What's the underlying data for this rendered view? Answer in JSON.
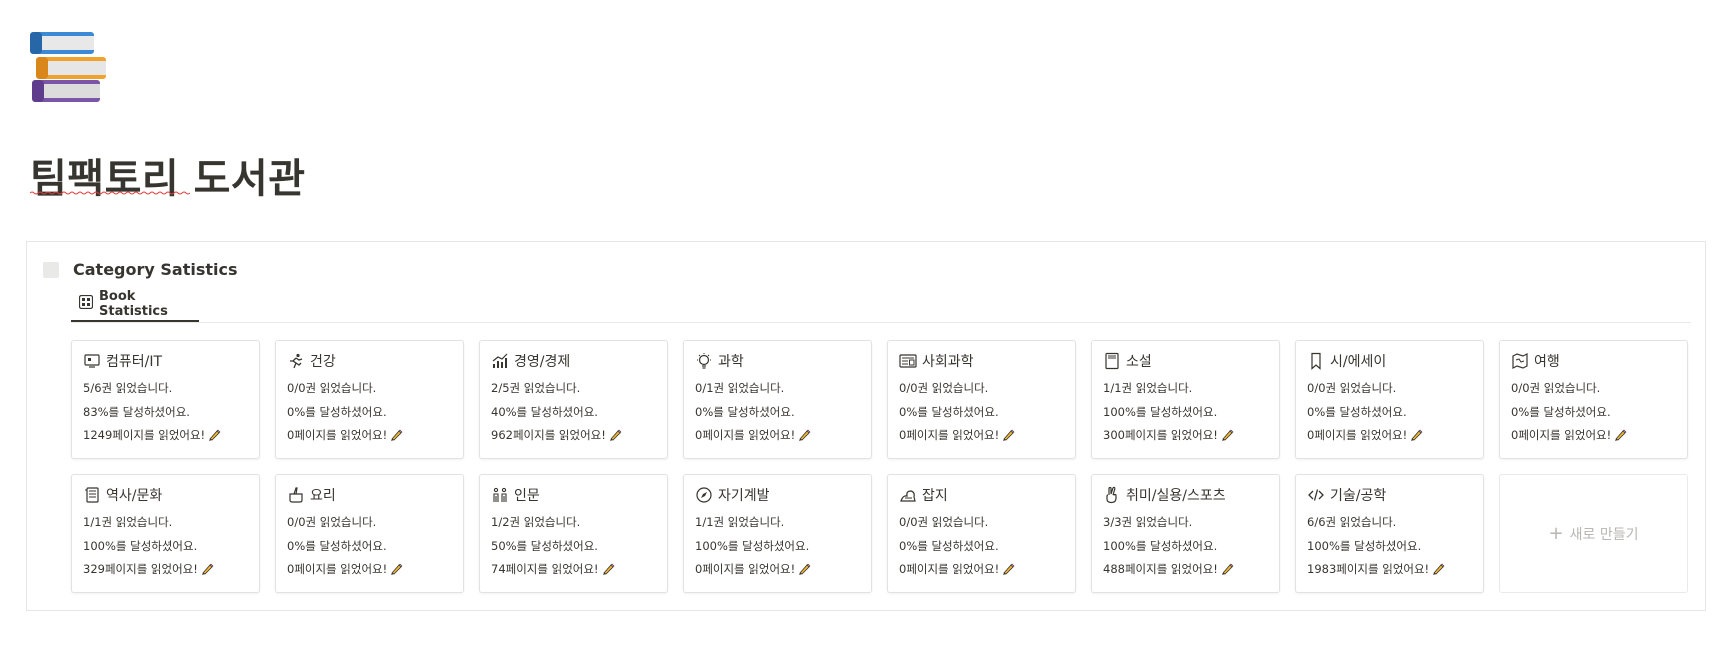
{
  "page": {
    "icon": "books-emoji-icon",
    "title": "팀팩토리 도서관"
  },
  "database": {
    "title": "Category Satistics",
    "view_tab": {
      "icon": "gallery-icon",
      "label": "Book Statistics"
    },
    "new_label": "새로 만들기"
  },
  "cards": [
    {
      "icon": "computer-icon",
      "title": "컴퓨터/IT",
      "line1": "5/6권 읽었습니다.",
      "line2": "83%를 달성하셨어요.",
      "line3": "1249페이지를 읽었어요!"
    },
    {
      "icon": "running-icon",
      "title": "건강",
      "line1": "0/0권 읽었습니다.",
      "line2": "0%를 달성하셨어요.",
      "line3": "0페이지를 읽었어요!"
    },
    {
      "icon": "chart-icon",
      "title": "경영/경제",
      "line1": "2/5권 읽었습니다.",
      "line2": "40%를 달성하셨어요.",
      "line3": "962페이지를 읽었어요!"
    },
    {
      "icon": "lightbulb-icon",
      "title": "과학",
      "line1": "0/1권 읽었습니다.",
      "line2": "0%를 달성하셨어요.",
      "line3": "0페이지를 읽었어요!"
    },
    {
      "icon": "newspaper-icon",
      "title": "사회과학",
      "line1": "0/0권 읽었습니다.",
      "line2": "0%를 달성하셨어요.",
      "line3": "0페이지를 읽었어요!"
    },
    {
      "icon": "book-icon",
      "title": "소설",
      "line1": "1/1권 읽었습니다.",
      "line2": "100%를 달성하셨어요.",
      "line3": "300페이지를 읽었어요!"
    },
    {
      "icon": "bookmark-icon",
      "title": "시/에세이",
      "line1": "0/0권 읽었습니다.",
      "line2": "0%를 달성하셨어요.",
      "line3": "0페이지를 읽었어요!"
    },
    {
      "icon": "map-icon",
      "title": "여행",
      "line1": "0/0권 읽었습니다.",
      "line2": "0%를 달성하셨어요.",
      "line3": "0페이지를 읽었어요!"
    },
    {
      "icon": "scroll-icon",
      "title": "역사/문화",
      "line1": "1/1권 읽었습니다.",
      "line2": "100%를 달성하셨어요.",
      "line3": "329페이지를 읽었어요!"
    },
    {
      "icon": "cooking-pot-icon",
      "title": "요리",
      "line1": "0/0권 읽었습니다.",
      "line2": "0%를 달성하셨어요.",
      "line3": "0페이지를 읽었어요!"
    },
    {
      "icon": "people-icon",
      "title": "인문",
      "line1": "1/2권 읽었습니다.",
      "line2": "50%를 달성하셨어요.",
      "line3": "74페이지를 읽었어요!"
    },
    {
      "icon": "compass-icon",
      "title": "자기계발",
      "line1": "1/1권 읽었습니다.",
      "line2": "100%를 달성하셨어요.",
      "line3": "0페이지를 읽었어요!"
    },
    {
      "icon": "magazine-icon",
      "title": "잡지",
      "line1": "0/0권 읽었습니다.",
      "line2": "0%를 달성하셨어요.",
      "line3": "0페이지를 읽었어요!"
    },
    {
      "icon": "peace-hand-icon",
      "title": "취미/실용/스포츠",
      "line1": "3/3권 읽었습니다.",
      "line2": "100%를 달성하셨어요.",
      "line3": "488페이지를 읽었어요!"
    },
    {
      "icon": "code-icon",
      "title": "기술/공학",
      "line1": "6/6권 읽었습니다.",
      "line2": "100%를 달성하셨어요.",
      "line3": "1983페이지를 읽었어요!"
    }
  ]
}
